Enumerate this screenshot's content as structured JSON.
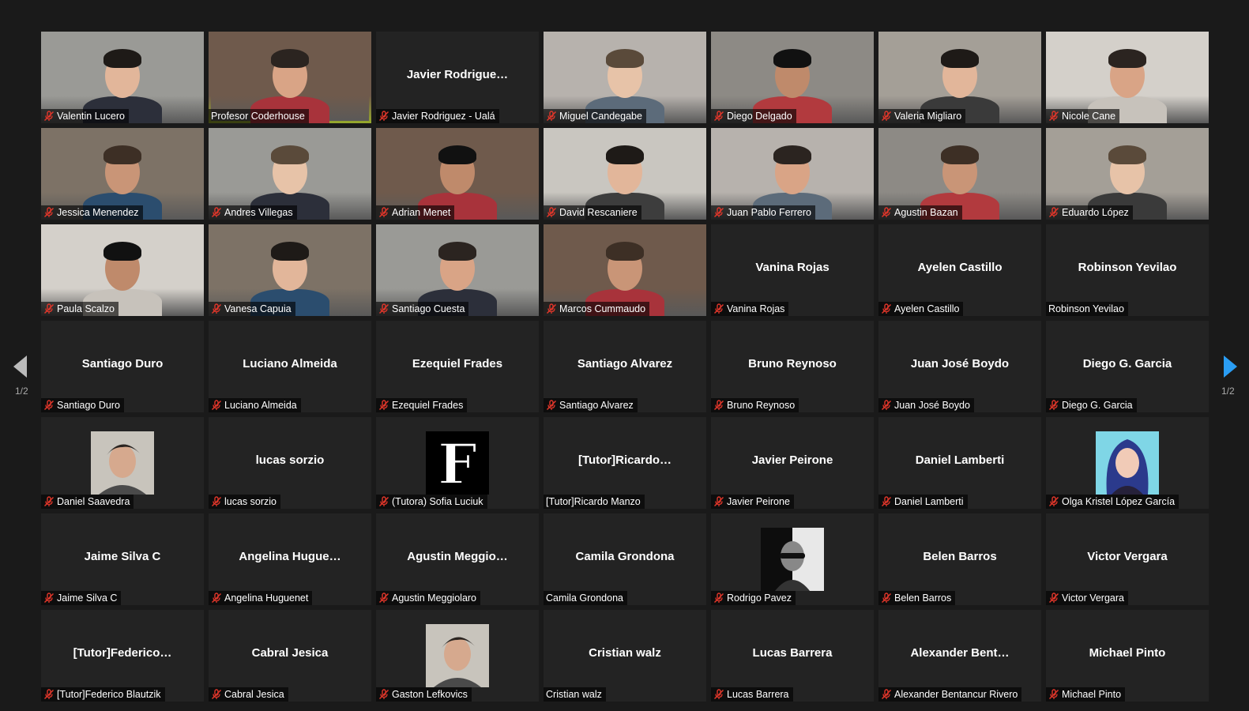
{
  "pagination": {
    "left_label": "1/2",
    "right_label": "1/2"
  },
  "colors": {
    "active_speaker": "#c8e13a",
    "muted_icon": "#e0362a",
    "next_arrow": "#2a9df4"
  },
  "participants": [
    {
      "name": "Valentin Lucero",
      "muted": true,
      "video": true
    },
    {
      "name": "Profesor Coderhouse",
      "muted": false,
      "video": true,
      "active": true
    },
    {
      "name": "Javier Rodriguez - Ualá",
      "display": "Javier  Rodrigue…",
      "muted": true
    },
    {
      "name": "Miguel Candegabe",
      "muted": true,
      "video": true
    },
    {
      "name": "Diego Delgado",
      "muted": true,
      "video": true
    },
    {
      "name": "Valeria Migliaro",
      "muted": true,
      "video": true
    },
    {
      "name": "Nicole Cane",
      "muted": true,
      "video": true
    },
    {
      "name": "Jessica Menendez",
      "muted": true,
      "video": true
    },
    {
      "name": "Andres Villegas",
      "muted": true,
      "video": true
    },
    {
      "name": "Adrian Menet",
      "muted": true,
      "video": true
    },
    {
      "name": "David Rescaniere",
      "muted": true,
      "video": true
    },
    {
      "name": "Juan Pablo Ferrero",
      "muted": true,
      "video": true
    },
    {
      "name": "Agustin Bazan",
      "muted": true,
      "video": true
    },
    {
      "name": "Eduardo López",
      "muted": true,
      "video": true
    },
    {
      "name": "Paula Scalzo",
      "muted": true,
      "video": true
    },
    {
      "name": "Vanesa Capuia",
      "muted": true,
      "video": true
    },
    {
      "name": "Santiago Cuesta",
      "muted": true,
      "video": true
    },
    {
      "name": "Marcos Cummaudo",
      "muted": true,
      "video": true
    },
    {
      "name": "Vanina Rojas",
      "display": "Vanina Rojas",
      "muted": true
    },
    {
      "name": "Ayelen Castillo",
      "display": "Ayelen Castillo",
      "muted": true
    },
    {
      "name": "Robinson Yevilao",
      "display": "Robinson Yevilao",
      "muted": false
    },
    {
      "name": "Santiago Duro",
      "display": "Santiago Duro",
      "muted": true
    },
    {
      "name": "Luciano Almeida",
      "display": "Luciano Almeida",
      "muted": true
    },
    {
      "name": "Ezequiel Frades",
      "display": "Ezequiel Frades",
      "muted": true
    },
    {
      "name": "Santiago Alvarez",
      "display": "Santiago Alvarez",
      "muted": true
    },
    {
      "name": "Bruno Reynoso",
      "display": "Bruno Reynoso",
      "muted": true
    },
    {
      "name": "Juan José Boydo",
      "display": "Juan José Boydo",
      "muted": true
    },
    {
      "name": "Diego G. Garcia",
      "display": "Diego G. Garcia",
      "muted": true
    },
    {
      "name": "Daniel Saavedra",
      "muted": true,
      "avatar": "photo-avatar"
    },
    {
      "name": "lucas sorzio",
      "display": "lucas sorzio",
      "muted": true
    },
    {
      "name": "(Tutora) Sofia Luciuk",
      "muted": true,
      "avatar": "letter-avatar",
      "avatar_letter": "F"
    },
    {
      "name": "[Tutor]Ricardo Manzo",
      "display": "[Tutor]Ricardo…",
      "muted": false
    },
    {
      "name": "Javier Peirone",
      "display": "Javier Peirone",
      "muted": true
    },
    {
      "name": "Daniel Lamberti",
      "display": "Daniel Lamberti",
      "muted": true
    },
    {
      "name": "Olga Kristel López García",
      "muted": true,
      "avatar": "illustrated-avatar"
    },
    {
      "name": "Jaime Silva C",
      "display": "Jaime Silva C",
      "muted": true
    },
    {
      "name": "Angelina Huguenet",
      "display": "Angelina  Hugue…",
      "muted": true
    },
    {
      "name": "Agustin Meggiolaro",
      "display": "Agustin  Meggio…",
      "muted": true
    },
    {
      "name": "Camila Grondona",
      "display": "Camila Grondona",
      "muted": false
    },
    {
      "name": "Rodrigo Pavez",
      "muted": true,
      "avatar": "bw-portrait-avatar"
    },
    {
      "name": "Belen Barros",
      "display": "Belen Barros",
      "muted": true
    },
    {
      "name": "Victor Vergara",
      "display": "Victor Vergara",
      "muted": true
    },
    {
      "name": "[Tutor]Federico Blautzik",
      "display": "[Tutor]Federico…",
      "muted": true
    },
    {
      "name": "Cabral Jesica",
      "display": "Cabral Jesica",
      "muted": true
    },
    {
      "name": "Gaston Lefkovics",
      "muted": true,
      "avatar": "photo-avatar"
    },
    {
      "name": "Cristian walz",
      "display": "Cristian walz",
      "muted": false
    },
    {
      "name": "Lucas Barrera",
      "display": "Lucas Barrera",
      "muted": true
    },
    {
      "name": "Alexander Bentancur Rivero",
      "display": "Alexander  Bent…",
      "muted": true
    },
    {
      "name": "Michael Pinto",
      "display": "Michael Pinto",
      "muted": true
    }
  ]
}
